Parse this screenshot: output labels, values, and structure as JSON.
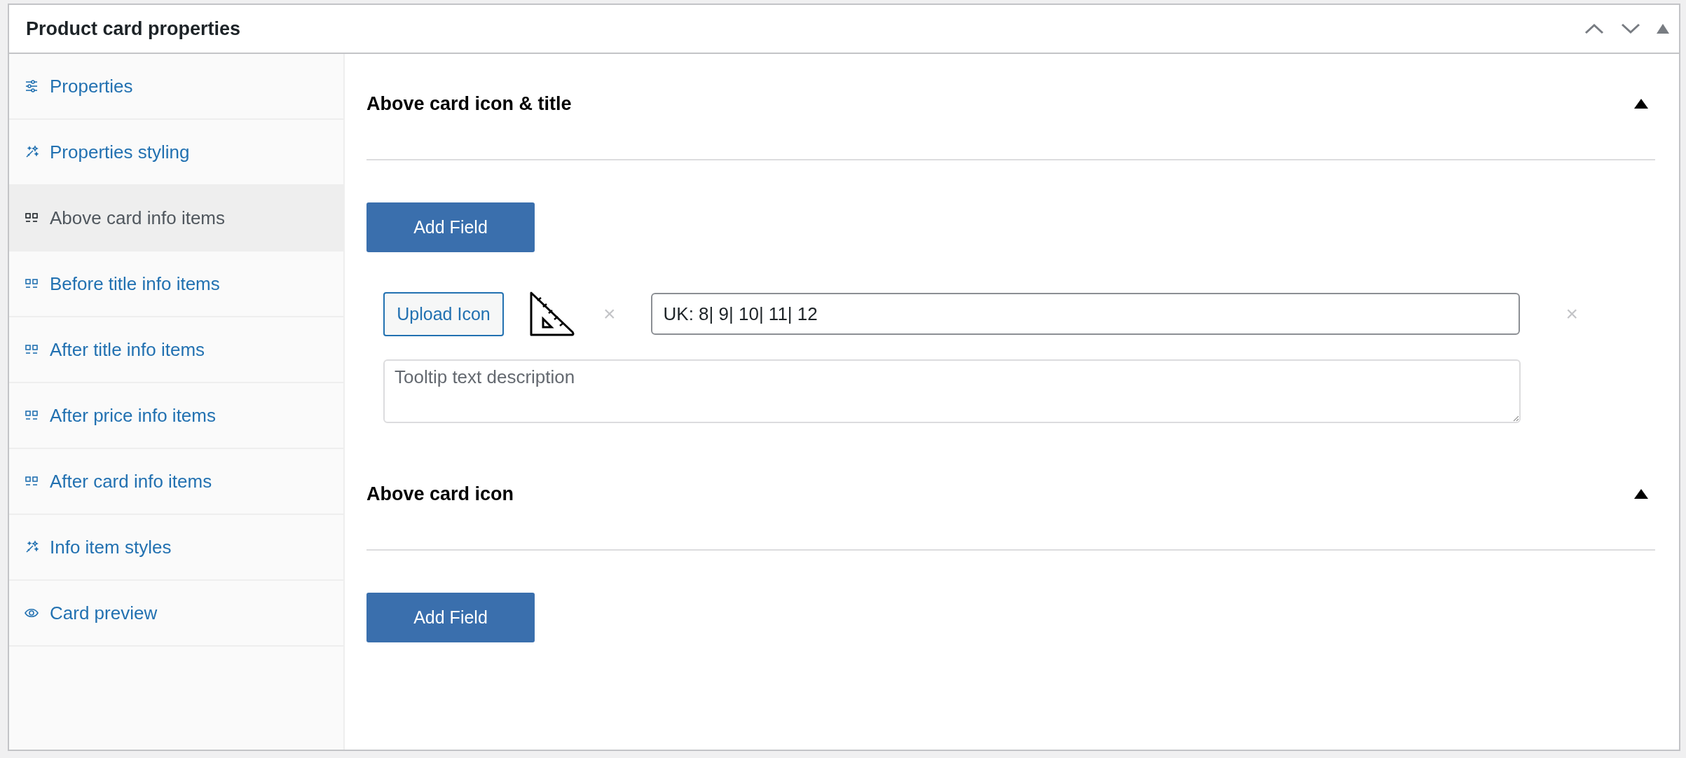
{
  "panel": {
    "title": "Product card properties",
    "expanded": true
  },
  "sidebar": {
    "items": [
      {
        "label": "Properties",
        "kind": "sliders",
        "selected": false
      },
      {
        "label": "Properties styling",
        "kind": "wand",
        "selected": false
      },
      {
        "label": "Above card info items",
        "kind": "blocks",
        "selected": true
      },
      {
        "label": "Before title info items",
        "kind": "blocks",
        "selected": false
      },
      {
        "label": "After title info items",
        "kind": "blocks",
        "selected": false
      },
      {
        "label": "After price info items",
        "kind": "blocks",
        "selected": false
      },
      {
        "label": "After card info items",
        "kind": "blocks",
        "selected": false
      },
      {
        "label": "Info item styles",
        "kind": "wand",
        "selected": false
      },
      {
        "label": "Card preview",
        "kind": "eye",
        "selected": false
      }
    ]
  },
  "sections": [
    {
      "title": "Above card icon & title",
      "expanded": true,
      "add_button": "Add Field",
      "fields": [
        {
          "upload_button": "Upload Icon",
          "remove_icon": "×",
          "value": "UK: 8| 9| 10| 11| 12",
          "remove_field": "×",
          "tooltip_placeholder": "Tooltip text description"
        }
      ]
    },
    {
      "title": "Above card icon",
      "expanded": true,
      "add_button": "Add Field"
    }
  ]
}
